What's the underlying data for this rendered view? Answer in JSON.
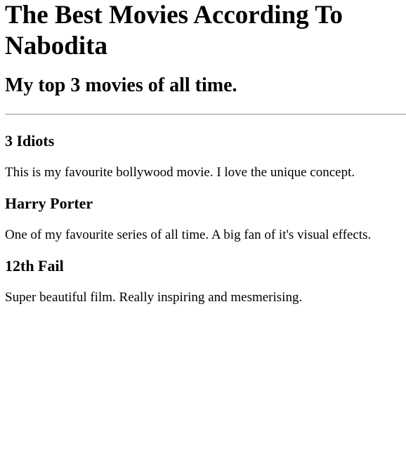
{
  "page": {
    "title": "The Best Movies According To Nabodita",
    "subtitle": "My top 3 movies of all time."
  },
  "movies": [
    {
      "name": "3 Idiots",
      "description": "This is my favourite bollywood movie. I love the unique concept."
    },
    {
      "name": "Harry Porter",
      "description": "One of my favourite series of all time. A big fan of it's visual effects."
    },
    {
      "name": "12th Fail",
      "description": "Super beautiful film. Really inspiring and mesmerising."
    }
  ]
}
